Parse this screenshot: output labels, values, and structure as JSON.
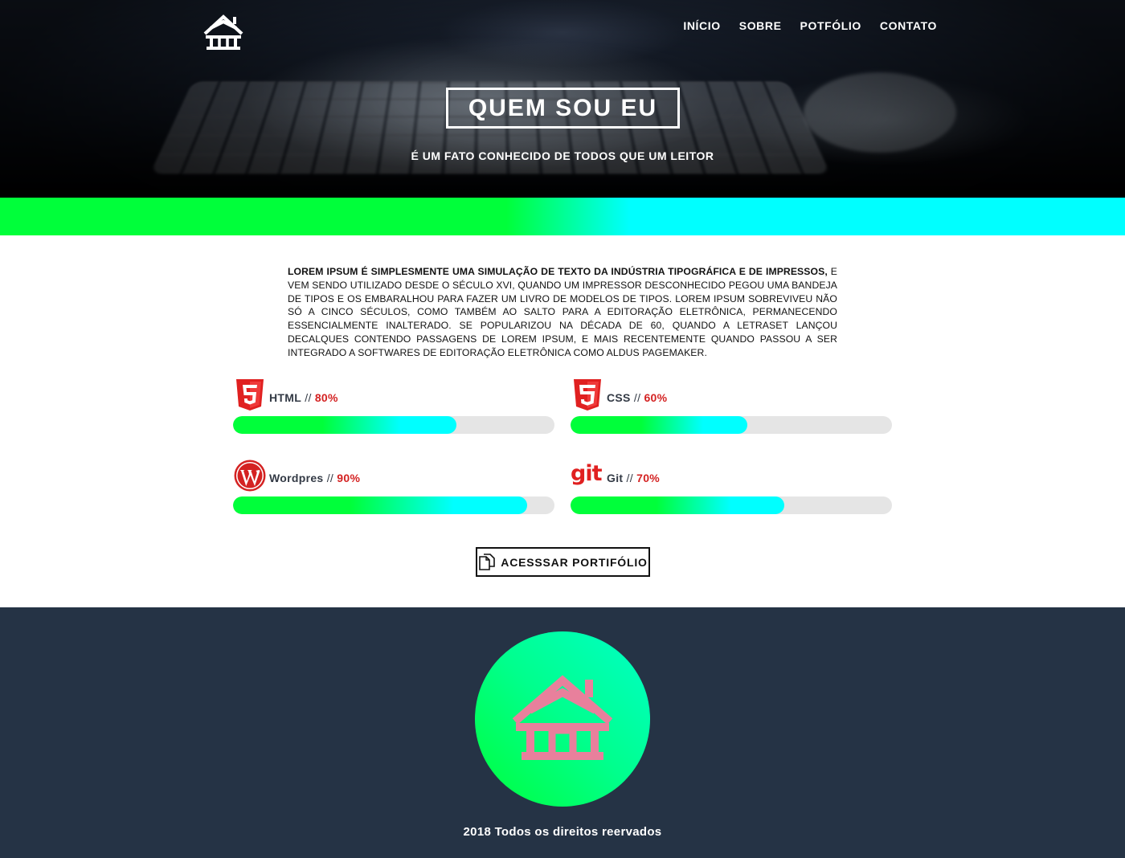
{
  "nav": {
    "items": [
      "INÍCIO",
      "SOBRE",
      "POTFÓLIO",
      "CONTATO"
    ]
  },
  "hero": {
    "title": "QUEM SOU EU",
    "subtitle": "É UM FATO CONHECIDO DE TODOS QUE UM LEITOR"
  },
  "intro": {
    "lead": "LOREM IPSUM É SIMPLESMENTE UMA SIMULAÇÃO DE TEXTO DA INDÚSTRIA TIPOGRÁFICA E DE IMPRESSOS,",
    "body": " E VEM SENDO UTILIZADO DESDE O SÉCULO XVI, QUANDO UM IMPRESSOR DESCONHECIDO PEGOU UMA BANDEJA DE TIPOS E OS EMBARALHOU PARA FAZER UM LIVRO DE MODELOS DE TIPOS. LOREM IPSUM SOBREVIVEU NÃO SÓ A CINCO SÉCULOS, COMO TAMBÉM AO SALTO PARA A EDITORAÇÃO ELETRÔNICA, PERMANECENDO ESSENCIALMENTE INALTERADO. SE POPULARIZOU NA DÉCADA DE 60, QUANDO A LETRASET LANÇOU DECALQUES CONTENDO PASSAGENS DE LOREM IPSUM, E MAIS RECENTEMENTE QUANDO PASSOU A SER INTEGRADO A SOFTWARES DE EDITORAÇÃO ELETRÔNICA COMO ALDUS PAGEMAKER."
  },
  "skills": [
    {
      "name": "HTML",
      "sep": " // ",
      "percent_label": "80%",
      "fill_fraction": 0.695,
      "icon": "html5-icon",
      "color": "#e02020"
    },
    {
      "name": "CSS",
      "sep": " // ",
      "percent_label": "60%",
      "fill_fraction": 0.55,
      "icon": "css3-icon",
      "color": "#e02020"
    },
    {
      "name": "Wordpres",
      "sep": " // ",
      "percent_label": "90%",
      "fill_fraction": 0.915,
      "icon": "wordpress-icon",
      "color": "#d42222"
    },
    {
      "name": "Git",
      "sep": " // ",
      "percent_label": "70%",
      "fill_fraction": 0.665,
      "icon": "git-icon",
      "color": "#e02020"
    }
  ],
  "portfolio_button": {
    "label": "ACESSSAR PORTIFÓLIO",
    "icon": "copy-icon"
  },
  "footer": {
    "copyright": "2018 Todos os direitos reervados",
    "logo_icon": "house-icon",
    "logo_color": "#e8809c"
  },
  "colors": {
    "accent_green": "#00ff3a",
    "accent_cyan": "#00ffff",
    "footer_bg": "#253345",
    "percent_red": "#d42222"
  }
}
